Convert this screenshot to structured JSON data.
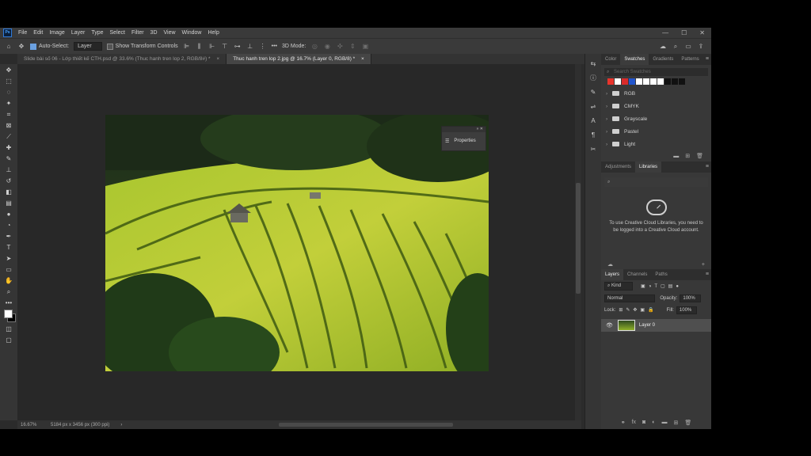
{
  "app": {
    "logo": "Ps"
  },
  "menu": [
    "File",
    "Edit",
    "Image",
    "Layer",
    "Type",
    "Select",
    "Filter",
    "3D",
    "View",
    "Window",
    "Help"
  ],
  "window_controls": [
    "—",
    "☐",
    "✕"
  ],
  "options_bar": {
    "auto_select_label": "Auto-Select:",
    "auto_select_checked": true,
    "auto_select_target": "Layer",
    "show_transform_label": "Show Transform Controls",
    "show_transform_checked": false,
    "more": "•••",
    "mode_3d": "3D Mode:"
  },
  "tabs": [
    {
      "label": "Slide bài số 06 - Lớp thiết kế CTH.psd @ 33.6% (Thuc hanh tren lop 2, RGB/8#) *",
      "active": false
    },
    {
      "label": "Thuc hanh tren lop 2.jpg @ 16.7% (Layer 0, RGB/8) *",
      "active": true
    }
  ],
  "tab_close": "×",
  "properties_panel": {
    "title": "Properties",
    "controls": "» ✕"
  },
  "status_bar": {
    "zoom": "16.67%",
    "doc_size": "5184 px x 3456 px (300 ppi)",
    "arrow": "›"
  },
  "swatches_panel": {
    "tabs": [
      "Color",
      "Swatches",
      "Gradients",
      "Patterns"
    ],
    "active_tab": "Swatches",
    "search_placeholder": "Search Swatches",
    "recent_colors": [
      "#e8342c",
      "#ffffff",
      "#d92b2b",
      "#2255cc",
      "#ffffff",
      "#ffffff",
      "#ffffff",
      "#ffffff",
      "#111111",
      "#111111",
      "#111111"
    ],
    "groups": [
      "RGB",
      "CMYK",
      "Grayscale",
      "Pastel",
      "Light"
    ]
  },
  "libraries_panel": {
    "tabs": [
      "Adjustments",
      "Libraries"
    ],
    "active_tab": "Libraries",
    "message": "To use Creative Cloud Libraries, you need to be logged into a Creative Cloud account."
  },
  "layers_panel": {
    "tabs": [
      "Layers",
      "Channels",
      "Paths"
    ],
    "active_tab": "Layers",
    "filter_label": "Kind",
    "blend_mode": "Normal",
    "opacity_label": "Opacity:",
    "opacity_value": "100%",
    "lock_label": "Lock:",
    "fill_label": "Fill:",
    "fill_value": "100%",
    "layers": [
      {
        "name": "Layer 0",
        "visible": true
      }
    ]
  },
  "colors": {
    "accent": "#2f7ad9",
    "app_bg": "#2b2b2b",
    "panel_bg": "#383838"
  }
}
